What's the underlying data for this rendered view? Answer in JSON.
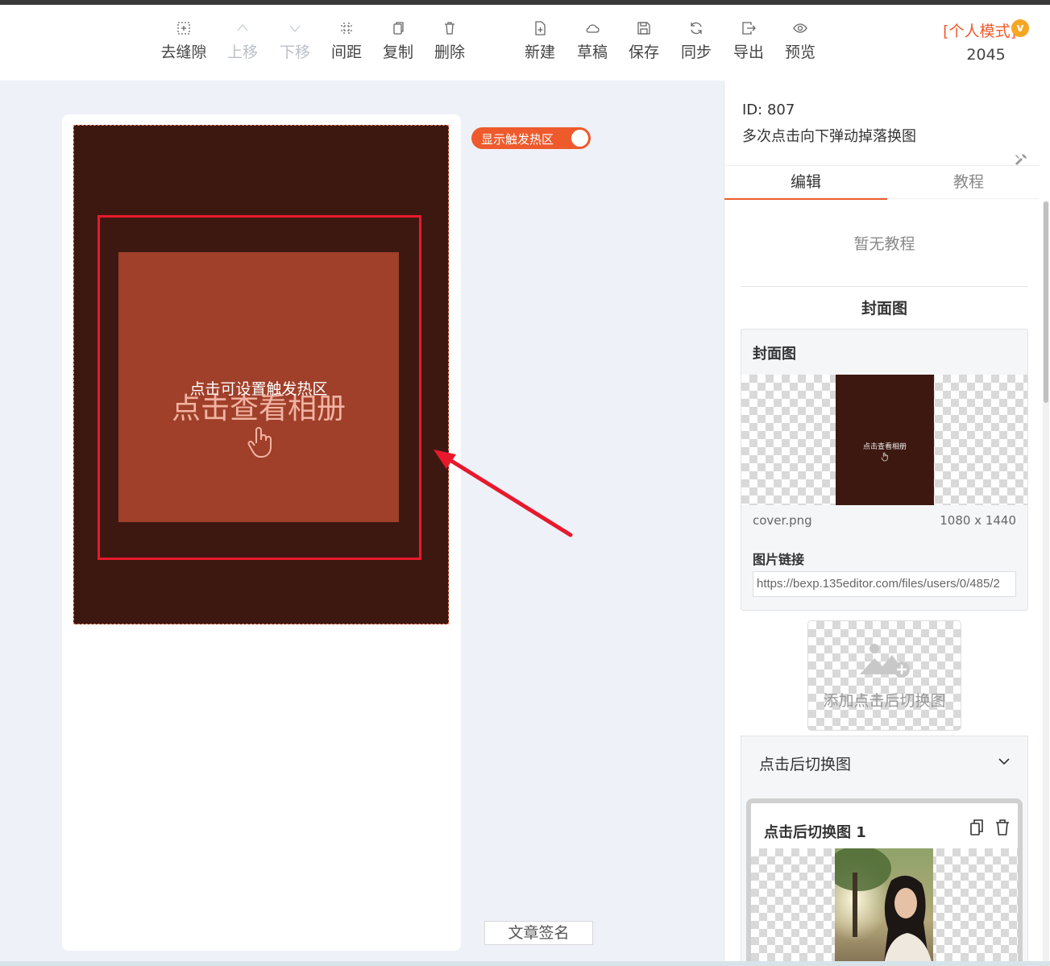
{
  "toolbar": {
    "buttons": [
      {
        "label": "去缝隙",
        "icon": "remove-gap-icon"
      },
      {
        "label": "上移",
        "icon": "chevron-up-icon"
      },
      {
        "label": "下移",
        "icon": "chevron-down-icon"
      },
      {
        "label": "间距",
        "icon": "spacing-icon"
      },
      {
        "label": "复制",
        "icon": "copy-icon"
      },
      {
        "label": "删除",
        "icon": "trash-icon"
      },
      {
        "label": "新建",
        "icon": "new-file-icon"
      },
      {
        "label": "草稿",
        "icon": "cloud-icon"
      },
      {
        "label": "保存",
        "icon": "save-icon"
      },
      {
        "label": "同步",
        "icon": "sync-icon"
      },
      {
        "label": "导出",
        "icon": "export-icon"
      },
      {
        "label": "预览",
        "icon": "eye-icon"
      }
    ],
    "mode_label": "[个人模式]",
    "mode_badge": "v",
    "mode_count": "2045"
  },
  "canvas": {
    "hotspot_toggle_label": "显示触发热区",
    "hotspot_hint": "点击可设置触发热区",
    "album_label": "点击查看相册",
    "signature_button": "文章签名"
  },
  "sidebar": {
    "id_text": "ID: 807",
    "title": "多次点击向下弹动掉落换图",
    "tabs": [
      "编辑",
      "教程"
    ],
    "active_tab": "编辑",
    "no_tutorial": "暂无教程",
    "section_title": "封面图",
    "cover": {
      "title": "封面图",
      "thumb_text": "点击查看相册",
      "filename": "cover.png",
      "dimensions": "1080 x 1440",
      "link_label": "图片链接",
      "link_value": "https://bexp.135editor.com/files/users/0/485/2"
    },
    "add_swap_label": "添加点击后切换图",
    "swap_panel": {
      "title": "点击后切换图",
      "card_title": "点击后切换图 1"
    }
  },
  "colors": {
    "accent": "#ee5a2c",
    "hotspot_bg": "#3d1811",
    "photo_bg": "#a0402a",
    "annotation_red": "#e8192c"
  }
}
